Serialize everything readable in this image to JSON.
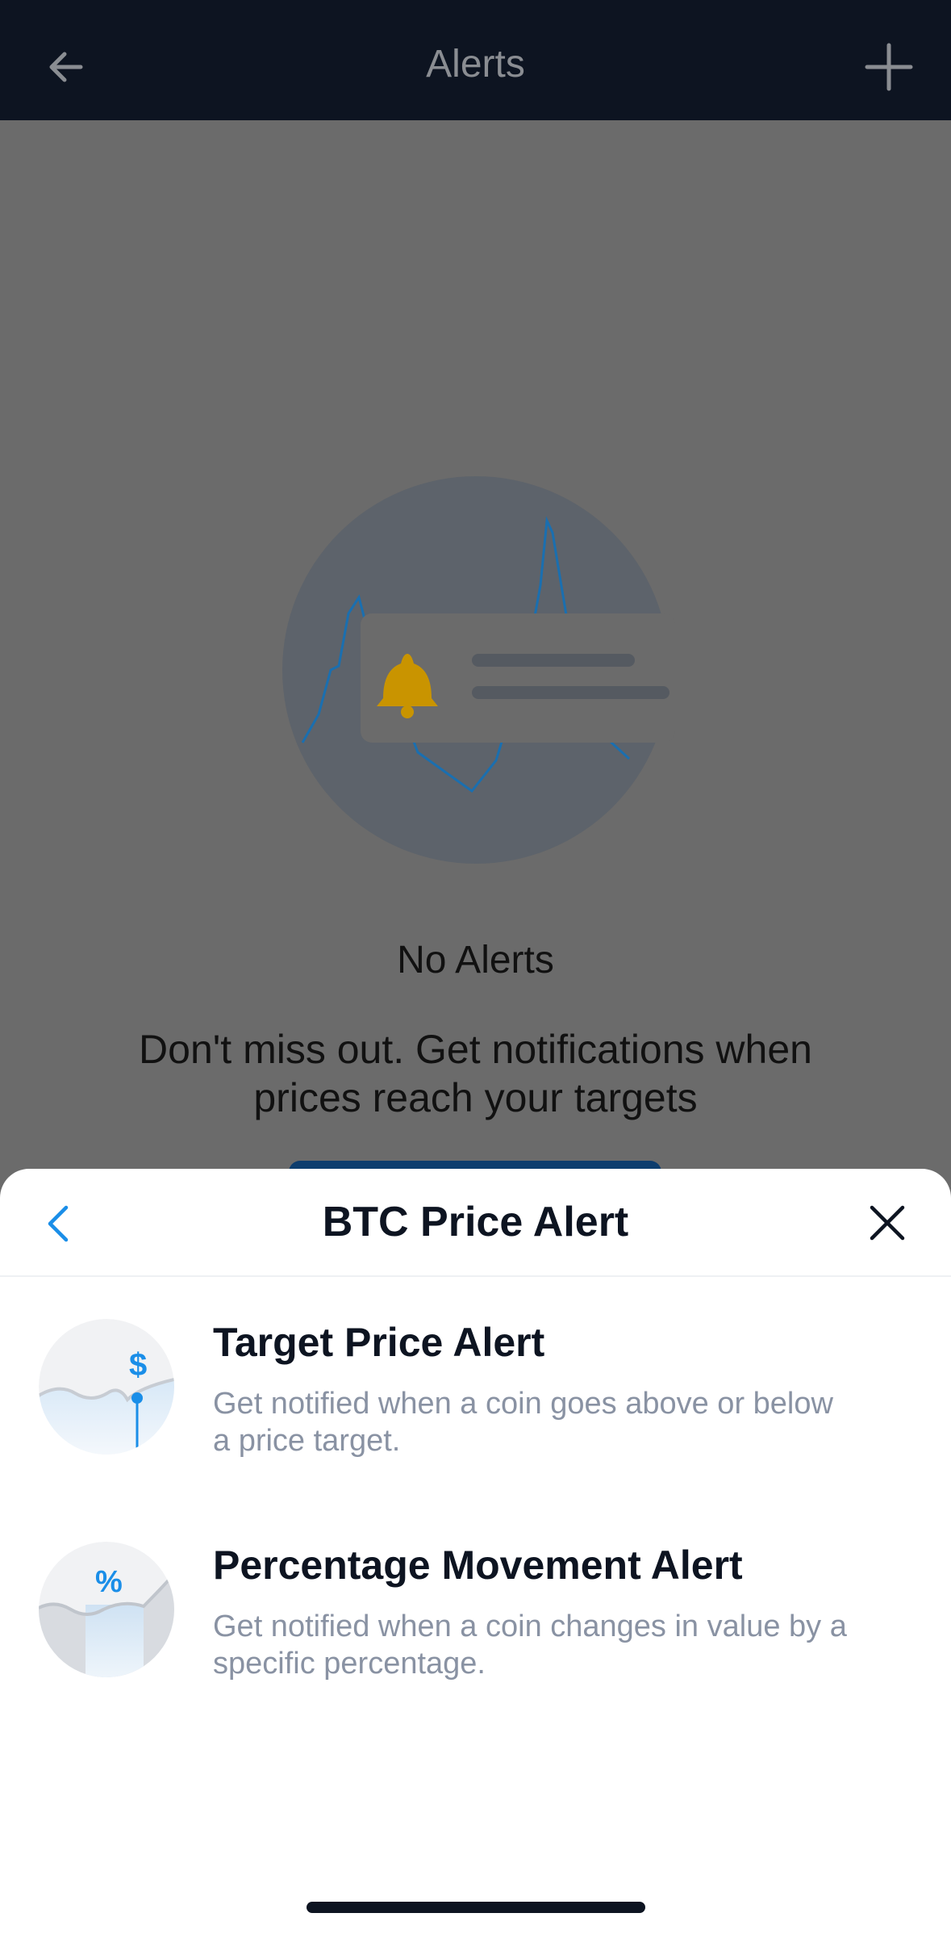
{
  "topbar": {
    "title": "Alerts",
    "back_icon": "arrow-left-icon",
    "add_icon": "plus-icon"
  },
  "empty_state": {
    "title": "No Alerts",
    "description": "Don't miss out. Get notifications when prices reach your targets"
  },
  "sheet": {
    "title": "BTC Price Alert",
    "back_icon": "chevron-left-icon",
    "close_icon": "close-icon",
    "options": [
      {
        "title": "Target Price Alert",
        "description": "Get notified when a coin goes above or below a price target.",
        "icon": "target-price-icon",
        "symbol": "$"
      },
      {
        "title": "Percentage Movement Alert",
        "description": "Get notified when a coin changes in value by a specific percentage.",
        "icon": "percentage-movement-icon",
        "symbol": "%"
      }
    ]
  },
  "colors": {
    "accent": "#1a8ee8",
    "topbar_bg": "#0d1421",
    "overlay": "#6b6b6b",
    "bell": "#c99400"
  }
}
